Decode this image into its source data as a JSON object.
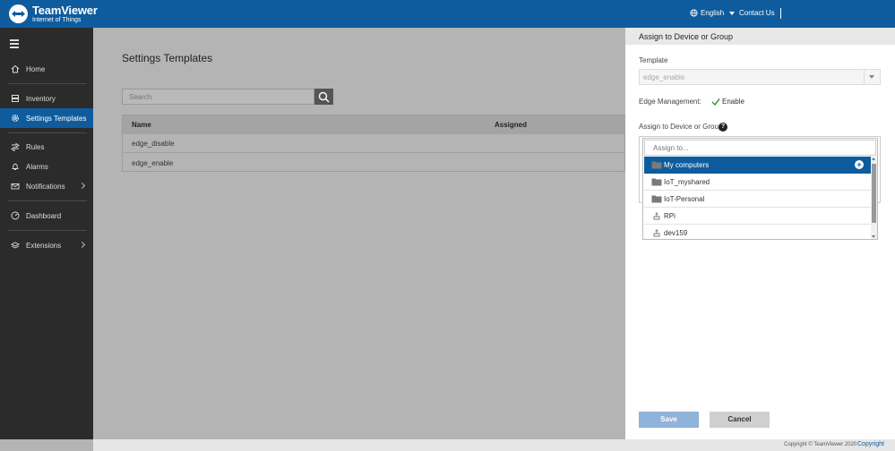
{
  "header": {
    "brand_title": "TeamViewer",
    "brand_subtitle": "Internet of Things",
    "language": "English",
    "contact": "Contact Us",
    "colors": {
      "brand": "#0e5c9e"
    }
  },
  "sidebar": {
    "items": [
      {
        "label": "Home",
        "icon": "home-icon"
      },
      {
        "label": "Inventory",
        "icon": "inventory-icon"
      },
      {
        "label": "Settings Templates",
        "icon": "gear-icon",
        "active": true
      },
      {
        "label": "Rules",
        "icon": "rules-icon"
      },
      {
        "label": "Alarms",
        "icon": "bell-icon"
      },
      {
        "label": "Notifications",
        "icon": "mail-icon",
        "has_submenu": true
      },
      {
        "label": "Dashboard",
        "icon": "dashboard-icon"
      },
      {
        "label": "Extensions",
        "icon": "extensions-icon",
        "has_submenu": true
      }
    ]
  },
  "main": {
    "title": "Settings Templates",
    "search_placeholder": "Search",
    "table": {
      "columns": [
        "Name",
        "Assigned"
      ],
      "rows": [
        {
          "name": "edge_disable"
        },
        {
          "name": "edge_enable"
        }
      ]
    }
  },
  "panel": {
    "title": "Assign to Device or Group",
    "template_label": "Template",
    "template_value": "edge_enable",
    "edge_label": "Edge Management:",
    "edge_value": "Enable",
    "assign_label": "Assign to Device or Group",
    "help": "?",
    "assign_placeholder": "Assign to...",
    "options": [
      {
        "label": "My computers",
        "type": "folder",
        "selected": true
      },
      {
        "label": "IoT_myshared",
        "type": "folder"
      },
      {
        "label": "IoT-Personal",
        "type": "folder"
      },
      {
        "label": "RPi",
        "type": "device"
      },
      {
        "label": "dev159",
        "type": "device"
      }
    ],
    "save_label": "Save",
    "cancel_label": "Cancel"
  },
  "footer": {
    "copyright_text": "Copyright © TeamViewer 2020",
    "copyright_link": "Copyright"
  }
}
